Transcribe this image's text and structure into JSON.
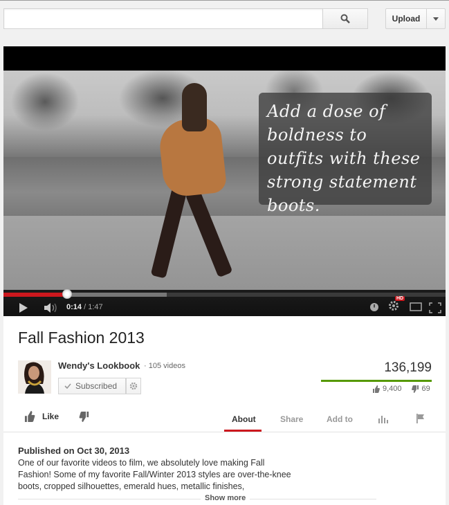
{
  "topbar": {
    "search_value": "",
    "search_placeholder": "",
    "upload_label": "Upload"
  },
  "player": {
    "overlay_text": "Add a dose of boldness to outfits with these strong statement boots.",
    "current_time": "0:14",
    "duration": "/ 1:47",
    "played_fraction": 0.14,
    "buffered_fraction": 0.37,
    "quality_badge": "HD"
  },
  "video": {
    "title": "Fall Fashion 2013",
    "views": "136,199",
    "likes": "9,400",
    "dislikes": "69"
  },
  "channel": {
    "name": "Wendy's Lookbook",
    "separator": "·",
    "video_count": "105 videos",
    "subscribed_label": "Subscribed"
  },
  "actions": {
    "like_label": "Like",
    "tabs": [
      {
        "label": "About",
        "active": true
      },
      {
        "label": "Share",
        "active": false
      },
      {
        "label": "Add to",
        "active": false
      }
    ]
  },
  "description": {
    "published": "Published on Oct 30, 2013",
    "text": "One of our favorite videos to film, we absolutely love making Fall Fashion! Some of my favorite Fall/Winter 2013 styles are over-the-knee boots, cropped silhouettes, emerald hues, metallic finishes,",
    "show_more": "Show more"
  },
  "colors": {
    "accent_red": "#cc181e",
    "views_bar_green": "#559900"
  }
}
